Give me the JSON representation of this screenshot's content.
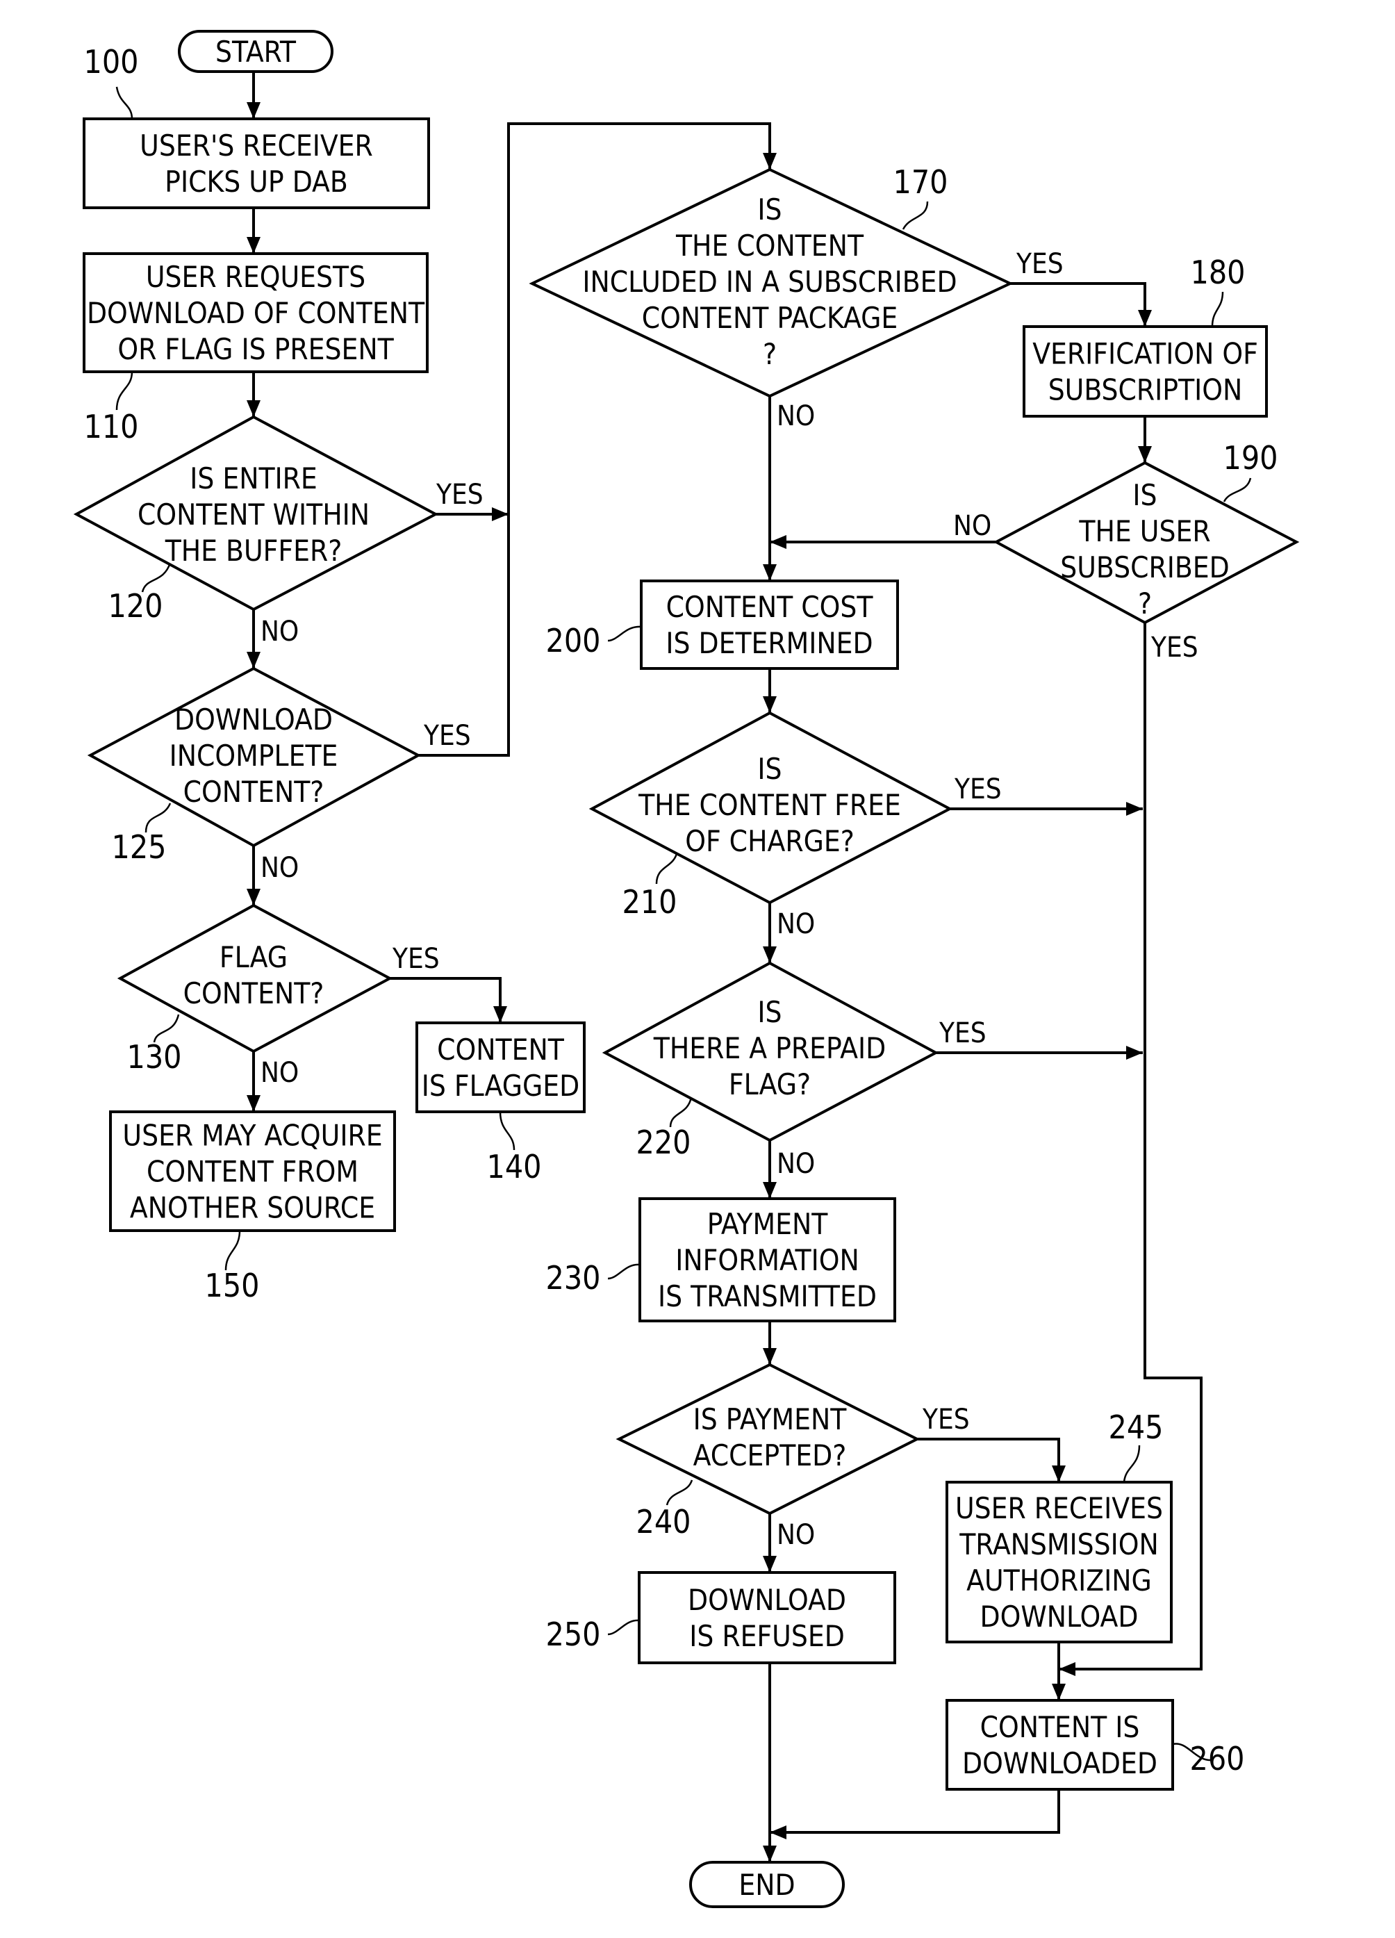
{
  "diagram": {
    "type": "flowchart",
    "terminals": {
      "start": {
        "label": "START"
      },
      "end": {
        "label": "END"
      }
    },
    "nodes": [
      {
        "id": "100",
        "ref": "100",
        "kind": "process",
        "lines": [
          "USER'S RECEIVER",
          "PICKS UP DAB"
        ]
      },
      {
        "id": "110",
        "ref": "110",
        "kind": "process",
        "lines": [
          "USER REQUESTS",
          "DOWNLOAD OF CONTENT",
          "OR FLAG IS PRESENT"
        ]
      },
      {
        "id": "120",
        "ref": "120",
        "kind": "decision",
        "lines": [
          "IS ENTIRE",
          "CONTENT WITHIN",
          "THE BUFFER?"
        ]
      },
      {
        "id": "125",
        "ref": "125",
        "kind": "decision",
        "lines": [
          "DOWNLOAD",
          "INCOMPLETE",
          "CONTENT?"
        ]
      },
      {
        "id": "130",
        "ref": "130",
        "kind": "decision",
        "lines": [
          "FLAG",
          "CONTENT?"
        ]
      },
      {
        "id": "140",
        "ref": "140",
        "kind": "process",
        "lines": [
          "CONTENT",
          "IS FLAGGED"
        ]
      },
      {
        "id": "150",
        "ref": "150",
        "kind": "process",
        "lines": [
          "USER MAY ACQUIRE",
          "CONTENT FROM",
          "ANOTHER SOURCE"
        ]
      },
      {
        "id": "170",
        "ref": "170",
        "kind": "decision",
        "lines": [
          "IS",
          "THE CONTENT",
          "INCLUDED IN A SUBSCRIBED",
          "CONTENT PACKAGE",
          "?"
        ]
      },
      {
        "id": "180",
        "ref": "180",
        "kind": "process",
        "lines": [
          "VERIFICATION OF",
          "SUBSCRIPTION"
        ]
      },
      {
        "id": "190",
        "ref": "190",
        "kind": "decision",
        "lines": [
          "IS",
          "THE USER",
          "SUBSCRIBED",
          "?"
        ]
      },
      {
        "id": "200",
        "ref": "200",
        "kind": "process",
        "lines": [
          "CONTENT COST",
          "IS DETERMINED"
        ]
      },
      {
        "id": "210",
        "ref": "210",
        "kind": "decision",
        "lines": [
          "IS",
          "THE CONTENT FREE",
          "OF CHARGE?"
        ]
      },
      {
        "id": "220",
        "ref": "220",
        "kind": "decision",
        "lines": [
          "IS",
          "THERE A PREPAID",
          "FLAG?"
        ]
      },
      {
        "id": "230",
        "ref": "230",
        "kind": "process",
        "lines": [
          "PAYMENT",
          "INFORMATION",
          "IS TRANSMITTED"
        ]
      },
      {
        "id": "240",
        "ref": "240",
        "kind": "decision",
        "lines": [
          "IS PAYMENT",
          "ACCEPTED?"
        ]
      },
      {
        "id": "245",
        "ref": "245",
        "kind": "process",
        "lines": [
          "USER RECEIVES",
          "TRANSMISSION",
          "AUTHORIZING",
          "DOWNLOAD"
        ]
      },
      {
        "id": "250",
        "ref": "250",
        "kind": "process",
        "lines": [
          "DOWNLOAD",
          "IS REFUSED"
        ]
      },
      {
        "id": "260",
        "ref": "260",
        "kind": "process",
        "lines": [
          "CONTENT IS",
          "DOWNLOADED"
        ]
      }
    ],
    "edges": [
      {
        "from": "start",
        "to": "100",
        "label": ""
      },
      {
        "from": "100",
        "to": "110",
        "label": ""
      },
      {
        "from": "110",
        "to": "120",
        "label": ""
      },
      {
        "from": "120",
        "to": "170",
        "label": "YES"
      },
      {
        "from": "120",
        "to": "125",
        "label": "NO"
      },
      {
        "from": "125",
        "to": "170",
        "label": "YES"
      },
      {
        "from": "125",
        "to": "130",
        "label": "NO"
      },
      {
        "from": "130",
        "to": "140",
        "label": "YES"
      },
      {
        "from": "130",
        "to": "150",
        "label": "NO"
      },
      {
        "from": "170",
        "to": "180",
        "label": "YES"
      },
      {
        "from": "170",
        "to": "200",
        "label": "NO"
      },
      {
        "from": "180",
        "to": "190",
        "label": ""
      },
      {
        "from": "190",
        "to": "200",
        "label": "NO"
      },
      {
        "from": "190",
        "to": "260",
        "label": "YES"
      },
      {
        "from": "200",
        "to": "210",
        "label": ""
      },
      {
        "from": "210",
        "to": "260",
        "label": "YES"
      },
      {
        "from": "210",
        "to": "220",
        "label": "NO"
      },
      {
        "from": "220",
        "to": "260",
        "label": "YES"
      },
      {
        "from": "220",
        "to": "230",
        "label": "NO"
      },
      {
        "from": "230",
        "to": "240",
        "label": ""
      },
      {
        "from": "240",
        "to": "245",
        "label": "YES"
      },
      {
        "from": "240",
        "to": "250",
        "label": "NO"
      },
      {
        "from": "245",
        "to": "260",
        "label": ""
      },
      {
        "from": "250",
        "to": "end",
        "label": ""
      },
      {
        "from": "260",
        "to": "end",
        "label": ""
      }
    ],
    "branch_labels": {
      "yes": "YES",
      "no": "NO"
    }
  }
}
